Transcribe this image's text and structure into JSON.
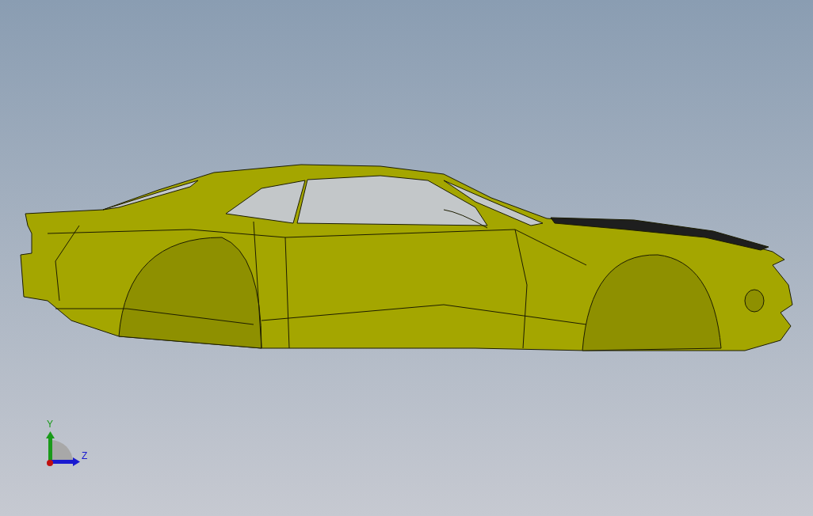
{
  "viewport": {
    "triad": {
      "axes": [
        {
          "label": "Y",
          "kind": "vertical",
          "color": "#1a9a1a"
        },
        {
          "label": "Z",
          "kind": "horizontal",
          "color": "#1a1ad0"
        }
      ]
    }
  }
}
